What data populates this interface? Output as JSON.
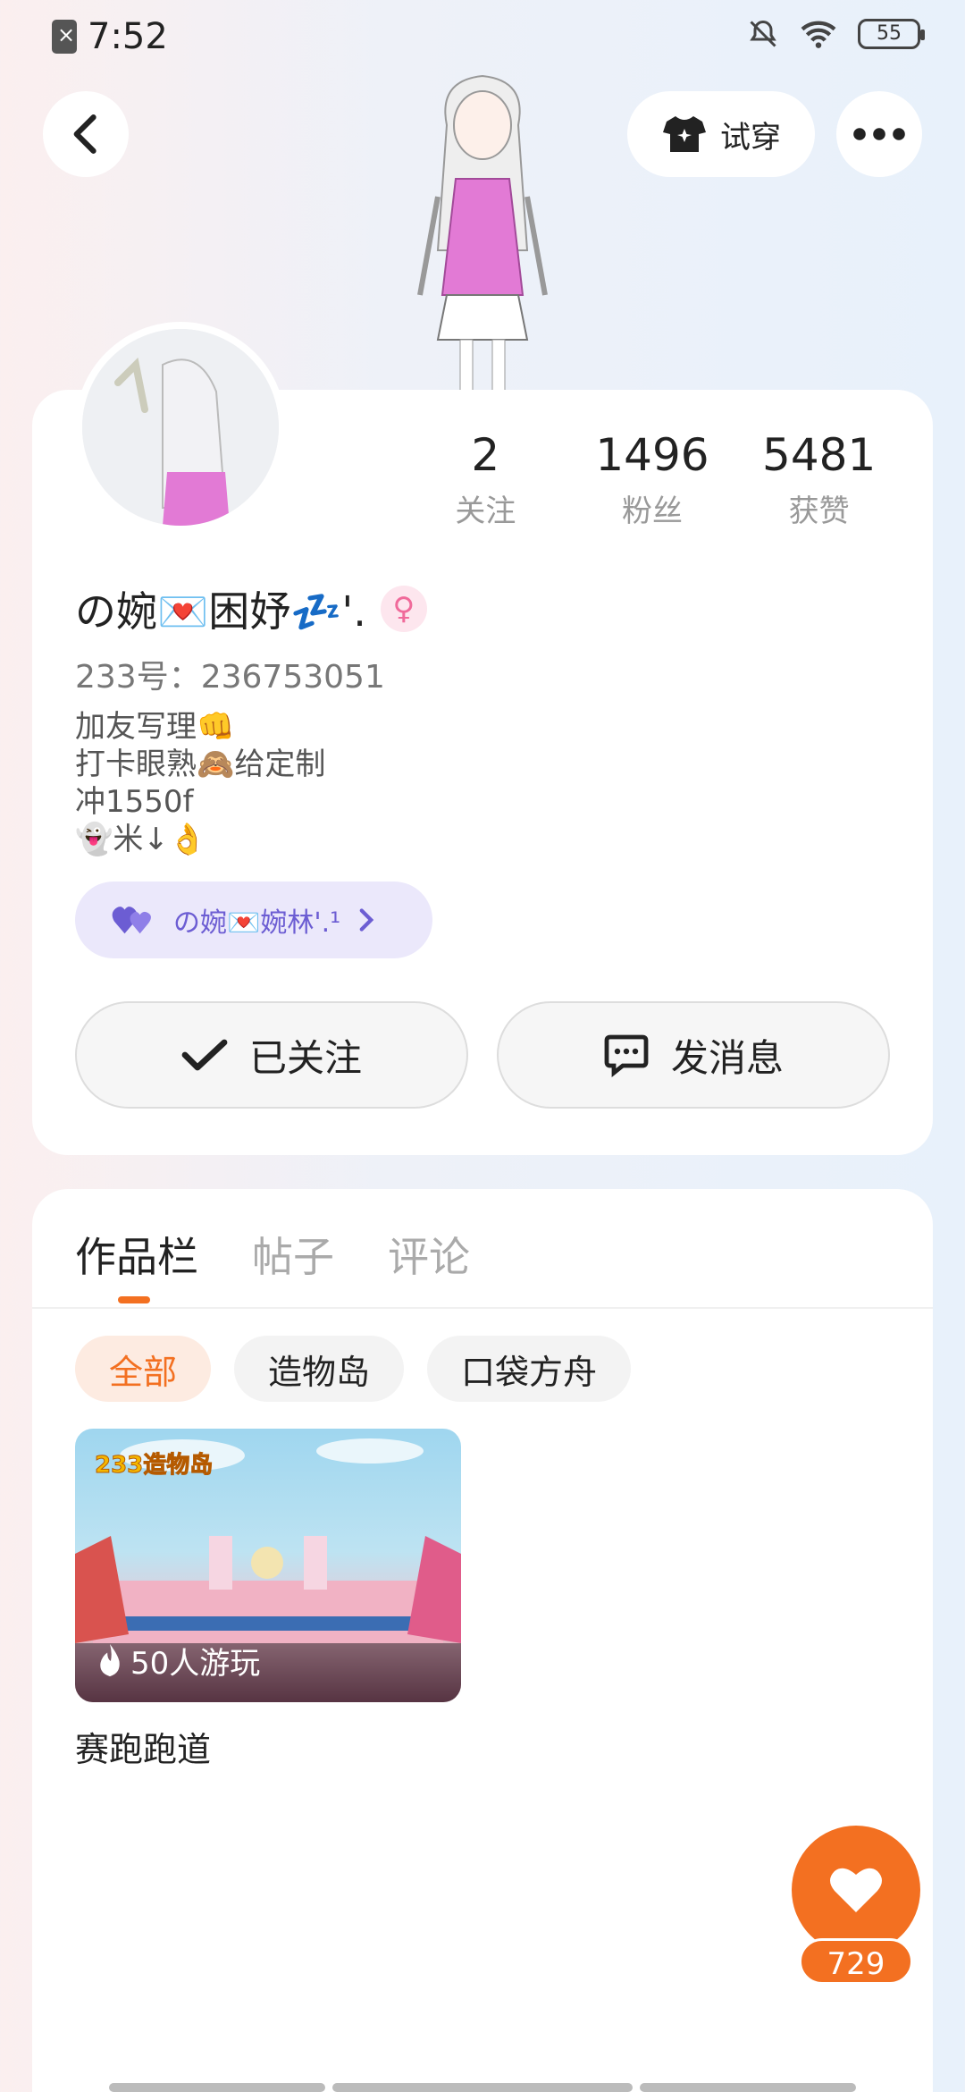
{
  "status_bar": {
    "time": "7:52",
    "battery": "55"
  },
  "header": {
    "tryon_label": "试穿"
  },
  "profile": {
    "stats": [
      {
        "num": "2",
        "label": "关注"
      },
      {
        "num": "1496",
        "label": "粉丝"
      },
      {
        "num": "5481",
        "label": "获赞"
      }
    ],
    "nickname": "の婉💌困妤💤'.",
    "gender_symbol": "♀",
    "user_id": "233号：236753051",
    "bio": [
      "加友写理👊",
      "打卡眼熟🙈给定制",
      "冲1550f",
      "👻米↓👌"
    ],
    "relation_label": "の婉💌婉林'.¹",
    "follow_label": "已关注",
    "message_label": "发消息"
  },
  "works": {
    "tabs": [
      "作品栏",
      "帖子",
      "评论"
    ],
    "filters": [
      "全部",
      "造物岛",
      "口袋方舟"
    ],
    "items": [
      {
        "plays": "50人游玩",
        "title": "赛跑跑道",
        "badge": "233造物岛"
      }
    ]
  },
  "like": {
    "count": "729"
  },
  "colors": {
    "accent": "#f37021",
    "relation": "#6c5dd3"
  }
}
